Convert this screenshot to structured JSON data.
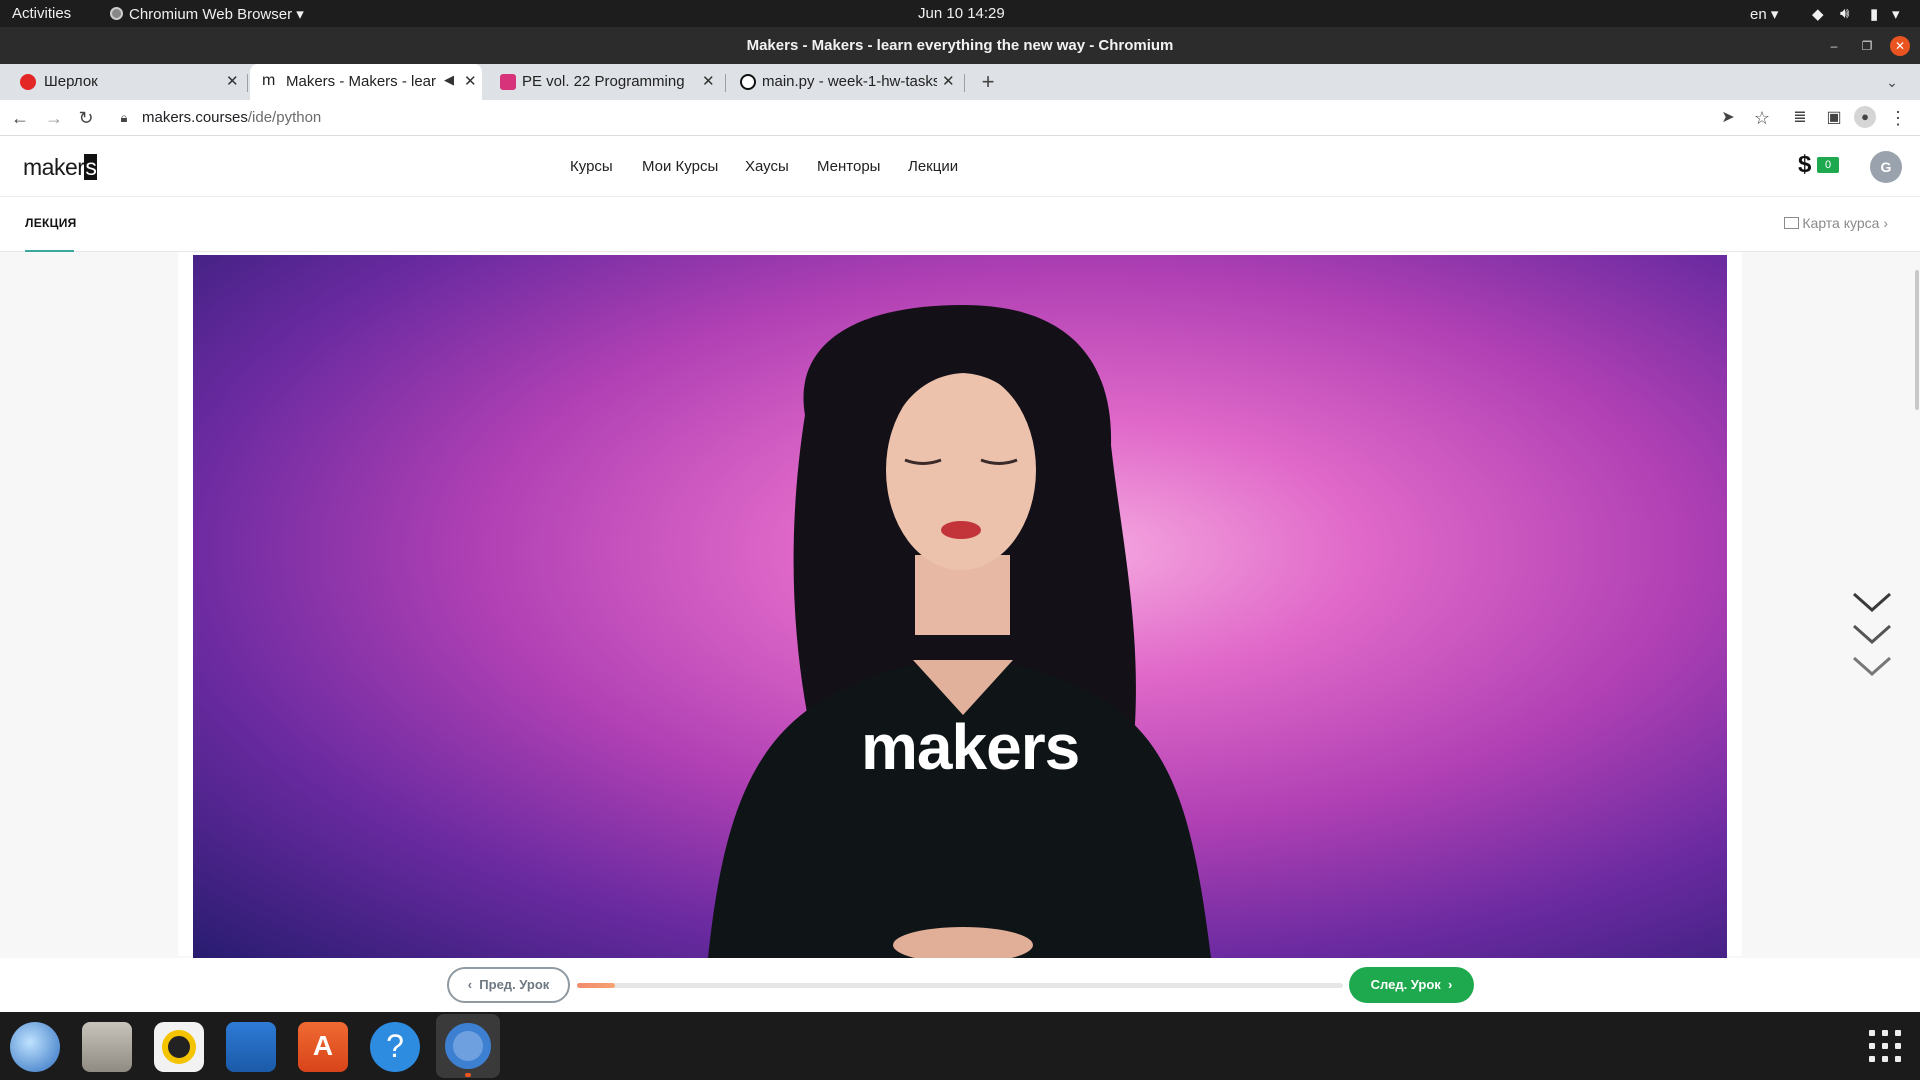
{
  "system": {
    "activities": "Activities",
    "app_menu": "Chromium Web Browser",
    "clock": "Jun 10  14:29",
    "language": "en"
  },
  "window": {
    "title": "Makers - Makers - learn everything the new way - Chromium"
  },
  "tabs": [
    {
      "label": "Шерлок",
      "favicon_color": "#e32626"
    },
    {
      "label": "Makers - Makers - learn",
      "favicon_color": "#222222"
    },
    {
      "label": "PE vol. 22 Programming",
      "favicon_color": "#d6337a"
    },
    {
      "label": "main.py - week-1-hw-tasks",
      "favicon_color": "#111111"
    }
  ],
  "address_bar": {
    "host": "makers.courses",
    "path": "/ide/python"
  },
  "site": {
    "logo": "maker",
    "logo_last": "s",
    "nav": [
      "Курсы",
      "Мои Курсы",
      "Хаусы",
      "Менторы",
      "Лекции"
    ],
    "balance_symbol": "$",
    "balance": "0",
    "avatar_initial": "G"
  },
  "lesson": {
    "tab_label": "ЛЕКЦИЯ",
    "course_map": "Карта курса",
    "video_shirt_text": "makers",
    "prev_label": "Пред. Урок",
    "next_label": "След. Урок",
    "progress_percent": 5
  },
  "colors": {
    "accent_green": "#1ea94e",
    "accent_teal": "#3aa7a0",
    "progress_orange": "#f38a6b"
  },
  "dock": [
    "thunderbird-icon",
    "files-icon",
    "rhythmbox-icon",
    "writer-icon",
    "software-icon",
    "help-icon",
    "chromium-icon"
  ]
}
